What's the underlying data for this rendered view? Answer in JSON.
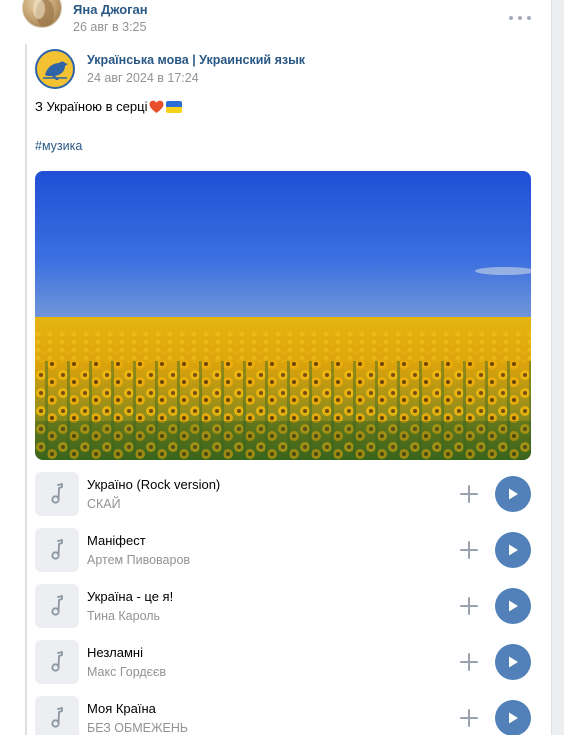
{
  "post": {
    "author_name": "Яна Джоган",
    "date": "26 авг в 3:25"
  },
  "repost": {
    "group_name": "Українська мова | Украинский язык",
    "date": "24 авг 2024 в 17:24",
    "text": "З Україною в серці",
    "hashtag": "#музика"
  },
  "tracks": [
    {
      "title": "Україно (Rock version)",
      "artist": "СКАЙ"
    },
    {
      "title": "Маніфест",
      "artist": "Артем Пивоваров"
    },
    {
      "title": "Україна - це я!",
      "artist": "Тина Кароль"
    },
    {
      "title": "Незламні",
      "artist": "Макс Гордєєв"
    },
    {
      "title": "Моя Країна",
      "artist": "БЕЗ ОБМЕЖЕНЬ"
    }
  ],
  "icons": {
    "more": "more-horizontal-icon",
    "heart": "heart-emoji",
    "flag": "ukraine-flag-emoji",
    "music": "music-note-icon",
    "add": "plus-icon",
    "play": "play-icon"
  },
  "colors": {
    "link": "#2a5885",
    "meta": "#939393",
    "play_button": "#5181b8",
    "cover_bg": "#eceef1"
  }
}
